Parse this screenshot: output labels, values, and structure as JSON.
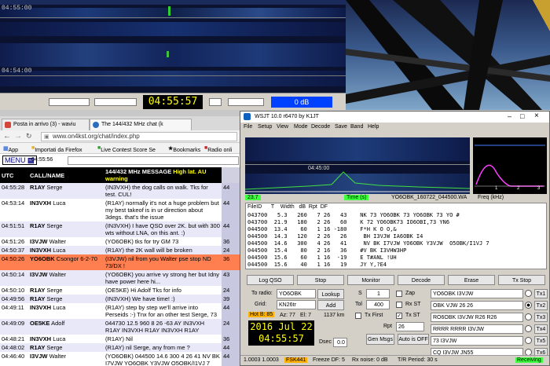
{
  "top_waterfall": {
    "times": [
      "04:55:00",
      "04:54:00"
    ],
    "clock": "04:55:57",
    "db": "0 dB"
  },
  "browser": {
    "tabs": [
      {
        "label": "Posta in arrivo (3) - waviu",
        "icon_color": "#d44638"
      },
      {
        "label": "The 144/432 MHz chat (k",
        "icon_color": "#2a6ebb"
      }
    ],
    "address": "www.on4kst.org/chat/index.php",
    "bookmarks": [
      "App",
      "Importati da Firefox",
      "Live Contest Score Se",
      "Bookmarks",
      "Radio onli"
    ],
    "menu_label": "MENU",
    "chat_time": "04:55:56",
    "columns": {
      "utc": "UTC",
      "call": "CALL/NAME",
      "message": "144/432 MHz MESSAGE",
      "warning": "High lat. AU warning"
    },
    "rows": [
      {
        "utc": "04:55:28",
        "call": "R1AY",
        "name": "Serge",
        "message": "(IN3VXH) the dog calls on walk. Tks for test. CUL!",
        "highlight": false
      },
      {
        "utc": "04:53:14",
        "call": "IN3VXH",
        "name": "Luca",
        "message": "(R1AY) normally it's not a huge problem but my best takeof is in ur direction about 3degs. that's the issue",
        "highlight": false
      },
      {
        "utc": "04:51:51",
        "call": "R1AY",
        "name": "Serge",
        "message": "(IN3VXH) I have QSO over 2K. but with 300 wts without LNA, on this ant. :)",
        "highlight": false
      },
      {
        "utc": "04:51:26",
        "call": "I3VJW",
        "name": "Walter",
        "message": "(YO6OBK) tks for try GM 73",
        "highlight": false
      },
      {
        "utc": "04:50:37",
        "call": "IN3VXH",
        "name": "Luca",
        "message": "(R1AY) the 2K wall will be broken",
        "highlight": false
      },
      {
        "utc": "04:50:26",
        "call": "YO6OBK",
        "name": "Csongor 6-2-70",
        "message": "(I3VJW) nil from you Walter pse stop ND 73/DX !",
        "highlight": true
      },
      {
        "utc": "04:50:14",
        "call": "I3VJW",
        "name": "Walter",
        "message": "(YO6OBK) you arrive vy strong her but Idny have power here hi...",
        "highlight": false
      },
      {
        "utc": "04:50:10",
        "call": "R1AY",
        "name": "Serge",
        "message": "(OE5KE) Hi Adolf Tks for info",
        "highlight": false
      },
      {
        "utc": "04:49:56",
        "call": "R1AY",
        "name": "Serge",
        "message": "(IN3VXH) We have time! :)",
        "highlight": false
      },
      {
        "utc": "04:49:11",
        "call": "IN3VXH",
        "name": "Luca",
        "message": "(R1AY) step by step we'll arrive into Perseids :-) Tnx for an other test Serge, 73",
        "highlight": false
      },
      {
        "utc": "04:49:09",
        "call": "OE5KE",
        "name": "Adolf",
        "message": "044730 12.5 960 8 26 -63 AY IN3VXH R1AY IN3VXH R1AY IN3VXH R1AY",
        "highlight": false
      },
      {
        "utc": "04:48:21",
        "call": "IN3VXH",
        "name": "Luca",
        "message": "(R1AY) Nil",
        "highlight": false
      },
      {
        "utc": "04:48:02",
        "call": "R1AY",
        "name": "Serge",
        "message": "(R1AY) nil Serge, any from me ?",
        "highlight": false
      },
      {
        "utc": "04:46:40",
        "call": "I3VJW",
        "name": "Walter",
        "message": "(YO6OBK) 044500 14.6 300 4 26 41 NV BK I7VJW YO6OBK Y3VJW O5OBK/I1VJ 7",
        "highlight": false
      }
    ],
    "sidebar_fragments": [
      "44",
      "44",
      "44",
      "36",
      "24",
      "36",
      "43",
      "24",
      "39",
      "44",
      "24",
      "36",
      "44",
      "44"
    ]
  },
  "wsjt": {
    "title": "WSJT 10.0   r6470    by K1JT",
    "menu": [
      "File",
      "Setup",
      "View",
      "Mode",
      "Decode",
      "Save",
      "Band",
      "Help"
    ],
    "wf_time": "04:45:00",
    "spec_axis": [
      "1",
      "2",
      "3"
    ],
    "spec_label": "Freq (kHz)",
    "status": {
      "left": "23.7",
      "mid": "Time (s)",
      "file": "YO6OBK_160722_044500.WA"
    },
    "decode_header": "FileID      T    Width   dB  Rpt  DF",
    "decode_lines": [
      "043700   5.3   260   7 26   43    NK 73 YO6OBK 73 YO6OBK 73 YO #",
      "043700  21.9   180   2 26   60    K 72 YO6OBK73 IO6OBI,73 YN6",
      "044500  13.4    60   1 16 -180    F*H K O O,&",
      "044500  14.3   120   2 26   26     BH I3VJW IA6OBK I4",
      "044500  14.6   300   4 26   41     NV BK I7VJW YO6OBK Y3VJW  O5OBK/I1VJ 7",
      "044500  15.4    80   2 16   36    #V BK I3VHW3HP",
      "044500  15.6    60   1 16  -19    E T#ANL !UH",
      "044500  15.6    40   1 16   19    JY Y,?E4"
    ],
    "buttons": [
      "Log QSO",
      "Stop",
      "Monitor",
      "Decode",
      "Erase",
      "Tx Stop"
    ],
    "to_radio_label": "To radio:",
    "to_radio": "YO6OBK",
    "grid_label": "Grid:",
    "grid": "KN26tr",
    "lookup": "Lookup",
    "add": "Add",
    "hot": "Hot B: 85",
    "az": "Az: 77",
    "el": "El: 7",
    "dist": "1137 km",
    "date": "2016 Jul 22",
    "clock": "04:55:57",
    "dsec_label": "Dsec",
    "dsec": "0.0",
    "s_label": "S",
    "s_value": "1",
    "tol_label": "Tol",
    "tol": "400",
    "zap": "Zap",
    "rx_st": "Rx ST",
    "tx_first": "Tx First",
    "tx_st": "Tx ST",
    "rpt_label": "Rpt",
    "rpt": "26",
    "gen_msgs": "Gen Msgs",
    "auto": "Auto is OFF",
    "tx_msgs": [
      "YO6OBK I3VJW",
      "OBK VJW 26 26",
      "RO6OBK I3VJW R26 R26",
      "RRRR RRRR I3VJW",
      "73 I3VJW",
      "CQ I3VJW JN55"
    ],
    "tx_labels": [
      "Tx1",
      "Tx2",
      "Tx3",
      "Tx4",
      "Tx5",
      "Tx6"
    ],
    "statusbar": {
      "a": "1.0003  1.0003",
      "mode": "FSK441",
      "freeze": "Freeze DF:  5",
      "rx": "Rx noise:  0 dB",
      "tr": "T/R Period: 30 s",
      "receiving": "Receiving"
    }
  }
}
